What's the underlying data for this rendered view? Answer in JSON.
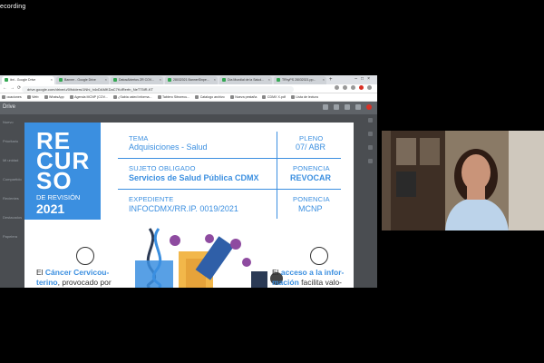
{
  "recording_label": "ecording",
  "browser": {
    "tabs": [
      {
        "label": "ibri - Google Drive",
        "active": true
      },
      {
        "label": "Banner - Google Drive",
        "active": false
      },
      {
        "label": "DatosAbiertos ZR COV...",
        "active": false
      },
      {
        "label": "28032021 BannerSinpe...",
        "active": false
      },
      {
        "label": "Día Mundial de la Salud...",
        "active": false
      },
      {
        "label": "TRhyPS 28032021.pp...",
        "active": false
      }
    ],
    "url": "drive.google.com/drive/u/0/folders/1Nhi_h4vDAMKDaC7KdRerfn_NeT75iR-KT",
    "bookmarks": [
      "ocaciones",
      "Web",
      "WhatsApp",
      "Agenda MCNP (COV...",
      "¿Sabía usted informa...",
      "Tablero Sitrorecu...",
      "Catalogo archivo",
      "Nueva pestaña",
      "CDMX X.pdf",
      "Lista de lectura"
    ],
    "drive_title": "Drive",
    "drive_sidebar": [
      "Nuevo",
      "Prioritario",
      "Mi unidad",
      "Compartido",
      "Recientes",
      "Destacados",
      "Papelera"
    ]
  },
  "slide": {
    "recurso_line1": "RE",
    "recurso_line2": "CUR",
    "recurso_line3": "SO",
    "subtitle": "DE REVISIÓN",
    "year": "2021",
    "tema_label": "TEMA",
    "tema_value": "Adquisiciones - Salud",
    "pleno_label": "PLENO",
    "pleno_value": "07/ ABR",
    "sujeto_label": "SUJETO OBLIGADO",
    "sujeto_value": "Servicios de Salud Pública CDMX",
    "ponencia_label_1": "PONENCIA",
    "ponencia_value_1": "REVOCAR",
    "expediente_label": "EXPEDIENTE",
    "expediente_value": "INFOCDMX/RR.IP. 0019/2021",
    "ponencia_label_2": "PONENCIA",
    "ponencia_value_2": "MCNP",
    "left_text_1": "El ",
    "left_text_bold": "Cáncer Cervicou-",
    "left_text_2": "terino",
    "left_text_3": ", provocado por",
    "right_text_1": "El ",
    "right_text_bold": "acceso a la infor-",
    "right_text_bold2": "mación",
    "right_text_3": " facilita valo-"
  },
  "colors": {
    "accent": "#3b8fe0",
    "background": "#000000"
  }
}
